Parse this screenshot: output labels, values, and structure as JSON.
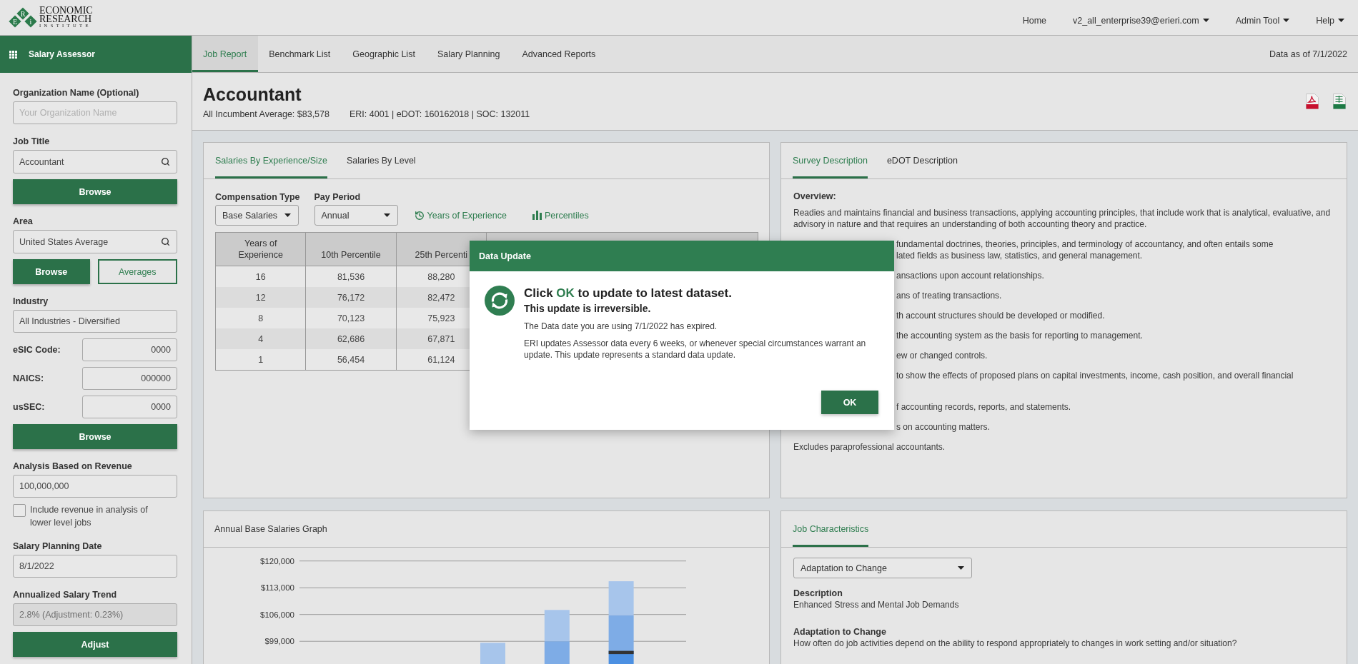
{
  "header": {
    "logo": {
      "letters": [
        "E",
        "R",
        "i"
      ],
      "lines": [
        "ECONOMIC",
        "RESEARCH",
        "INSTITUTE"
      ]
    },
    "nav": [
      {
        "label": "Home",
        "kind": "link"
      },
      {
        "label": "v2_all_enterprise39@erieri.com",
        "kind": "dropdown"
      },
      {
        "label": "Admin Tool",
        "kind": "dropdown"
      },
      {
        "label": "Help",
        "kind": "dropdown"
      }
    ]
  },
  "app_title": "Salary Assessor",
  "tabs": [
    {
      "label": "Job Report",
      "selected": true
    },
    {
      "label": "Benchmark List",
      "selected": false
    },
    {
      "label": "Geographic List",
      "selected": false
    },
    {
      "label": "Salary Planning",
      "selected": false
    },
    {
      "label": "Advanced Reports",
      "selected": false
    }
  ],
  "data_date": "Data as of 7/1/2022",
  "sidebar": {
    "items": [
      {
        "kind": "field",
        "label": "Organization Name (Optional)",
        "placeholder": "Your Organization Name",
        "search": false,
        "disabled": false
      },
      {
        "kind": "field",
        "label": "Job Title",
        "value": "Accountant",
        "search": true,
        "disabled": false
      },
      {
        "kind": "buttons",
        "buttons": [
          {
            "label": "Browse",
            "kind": "primary"
          }
        ]
      },
      {
        "kind": "field",
        "label": "Area",
        "value": "United States Average",
        "search": true,
        "disabled": false
      },
      {
        "kind": "buttons",
        "buttons": [
          {
            "label": "Browse",
            "kind": "primary"
          },
          {
            "label": "Averages",
            "kind": "outline"
          }
        ]
      },
      {
        "kind": "field",
        "label": "Industry",
        "value": "All Industries - Diversified",
        "search": false,
        "disabled": false
      },
      {
        "kind": "code",
        "label": "eSIC Code:",
        "value": "0000"
      },
      {
        "kind": "code",
        "label": "NAICS:",
        "value": "000000"
      },
      {
        "kind": "code",
        "label": "usSEC:",
        "value": "0000"
      },
      {
        "kind": "buttons",
        "buttons": [
          {
            "label": "Browse",
            "kind": "primary"
          }
        ]
      },
      {
        "kind": "field",
        "label": "Analysis Based on Revenue",
        "value": "100,000,000",
        "search": false,
        "disabled": false
      },
      {
        "kind": "checkbox",
        "label": "Include revenue in analysis of lower level jobs",
        "checked": false
      },
      {
        "kind": "field",
        "label": "Salary Planning Date",
        "value": "8/1/2022",
        "search": false,
        "disabled": false
      },
      {
        "kind": "field",
        "label": "Annualized Salary Trend",
        "value": "2.8% (Adjustment: 0.23%)",
        "search": false,
        "disabled": true
      },
      {
        "kind": "buttons",
        "buttons": [
          {
            "label": "Adjust",
            "kind": "primary"
          }
        ]
      }
    ]
  },
  "job": {
    "title": "Accountant",
    "average": "All Incumbent Average: $83,578",
    "codes": "ERI: 4001 | eDOT: 160162018 | SOC: 132011",
    "exports": [
      {
        "kind": "pdf"
      },
      {
        "kind": "excel"
      }
    ]
  },
  "salary_panel": {
    "tabs": [
      {
        "label": "Salaries By Experience/Size",
        "selected": true
      },
      {
        "label": "Salaries By Level",
        "selected": false
      }
    ],
    "filters": [
      {
        "label": "Compensation Type",
        "value": "Base Salaries"
      },
      {
        "label": "Pay Period",
        "value": "Annual"
      }
    ],
    "views": [
      {
        "label": "Years of Experience",
        "kind": "history"
      },
      {
        "label": "Percentiles",
        "kind": "bars"
      }
    ],
    "table": {
      "columns": [
        "Years of Experience",
        "10th Percentile",
        "25th Percenti"
      ],
      "rows": [
        [
          "16",
          "81,536",
          "88,280"
        ],
        [
          "12",
          "76,172",
          "82,472"
        ],
        [
          "8",
          "70,123",
          "75,923"
        ],
        [
          "4",
          "62,686",
          "67,871"
        ],
        [
          "1",
          "56,454",
          "61,124"
        ]
      ]
    }
  },
  "survey_panel": {
    "tabs": [
      {
        "label": "Survey Description",
        "selected": true
      },
      {
        "label": "eDOT Description",
        "selected": false
      }
    ],
    "heading": "Overview:",
    "paragraphs": [
      {
        "kind": "whole",
        "lines": [
          "Readies and maintains financial and business transactions, applying accounting principles, that include work that is analytical, evaluative, and advisory in nature and that requires an understanding of both accounting theory and practice."
        ]
      },
      {
        "kind": "cut",
        "lines": [
          "fundamental doctrines, theories, principles, and terminology of accountancy, and often entails some",
          "lated fields as business law, statistics, and general management."
        ]
      },
      {
        "kind": "cut",
        "lines": [
          "ansactions upon account relationships."
        ]
      },
      {
        "kind": "cut",
        "lines": [
          "ans of treating transactions."
        ]
      },
      {
        "kind": "cut",
        "lines": [
          "th account structures should be developed or modified."
        ]
      },
      {
        "kind": "cut",
        "lines": [
          "the accounting system as the basis for reporting to management."
        ]
      },
      {
        "kind": "cut",
        "lines": [
          "ew or changed controls."
        ]
      },
      {
        "kind": "cut-wrapped",
        "lines": [
          "to show the effects of proposed plans on capital investments, income, cash position, and overall financial"
        ]
      },
      {
        "kind": "cut",
        "lines": [
          "f accounting records, reports, and statements."
        ]
      },
      {
        "kind": "cut",
        "lines": [
          "s on accounting matters."
        ]
      },
      {
        "kind": "whole",
        "lines": [
          "Excludes paraprofessional accountants."
        ]
      }
    ]
  },
  "graph_panel": {
    "title": "Annual Base Salaries Graph",
    "y_ticks": [
      "$120,000",
      "$113,000",
      "$106,000",
      "$99,000"
    ]
  },
  "characteristics_panel": {
    "tabs": [
      {
        "label": "Job Characteristics",
        "selected": true
      }
    ],
    "select": "Adaptation to Change",
    "details": [
      {
        "label": "Description",
        "value": "Enhanced Stress and Mental Job Demands"
      },
      {
        "label": "Adaptation to Change",
        "value": "How often do job activities depend on the ability to respond appropriately to changes in work setting and/or situation?"
      }
    ]
  },
  "dialog": {
    "title": "Data Update",
    "heading": [
      {
        "kind": "plain",
        "text": "Click "
      },
      {
        "kind": "accent",
        "text": "OK"
      },
      {
        "kind": "plain",
        "text": " to update to latest dataset."
      }
    ],
    "subheading": "This update is irreversible.",
    "paragraphs": [
      "The Data date you are using 7/1/2022 has expired.",
      "ERI updates Assessor data every 6 weeks, or whenever special circumstances warrant an update. This update represents a standard data update."
    ],
    "button": "OK"
  }
}
